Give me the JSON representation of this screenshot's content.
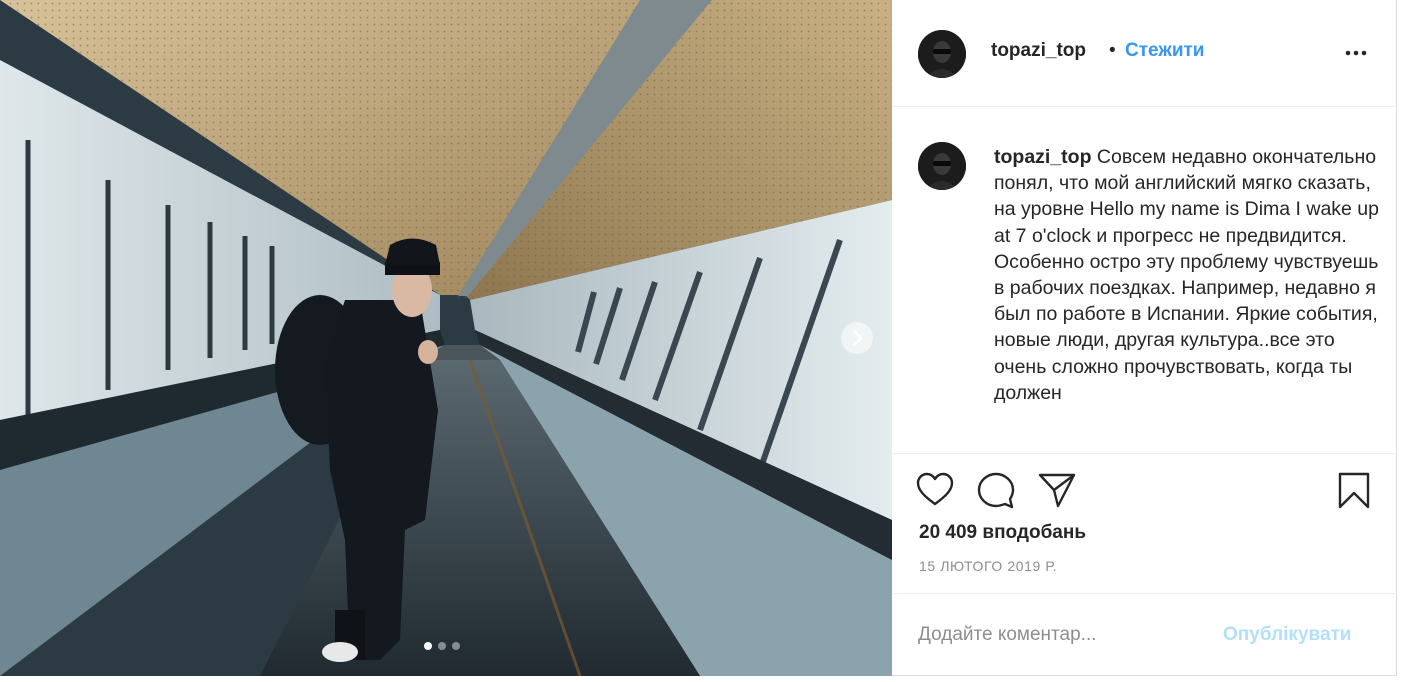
{
  "post": {
    "username": "topazi_top",
    "separator": "•",
    "follow_label": "Стежити",
    "caption_text": "Совсем недавно окончательно понял, что мой английский мягко сказать, на уровне Hello my name is Dima I wake up at 7 o'clock и прогресс не предвидится. Особенно остро эту проблему чувствуешь в рабочих поездках. Например, недавно я был по работе в Испании. Яркие события, новые люди, другая культура..все это очень сложно прочувствовать, когда ты должен",
    "likes": "20 409 вподобань",
    "date": "15 ЛЮТОГО 2019 Р.",
    "comment_placeholder": "Додайте коментар...",
    "publish_label": "Опублікувати",
    "carousel": {
      "total_slides": 3,
      "active_slide": 1
    }
  },
  "icons": {
    "more": "more-options-icon",
    "like": "heart-icon",
    "comment": "comment-icon",
    "share": "paper-plane-icon",
    "save": "bookmark-icon",
    "next": "chevron-right-icon"
  },
  "colors": {
    "link": "#3897f0",
    "publish_disabled": "#b2dffc",
    "text": "#262626",
    "muted": "#8e8e8e"
  }
}
